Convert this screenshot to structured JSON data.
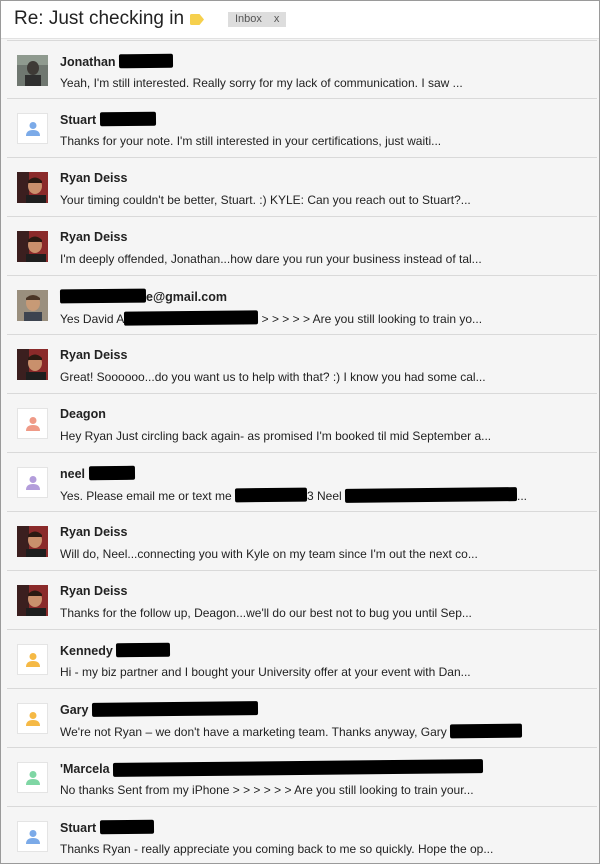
{
  "header": {
    "subject": "Re: Just checking in",
    "label_icon": "label-tag-icon",
    "label_color": "#f6d04d",
    "inbox_chip": "Inbox",
    "inbox_chip_close": "x"
  },
  "messages": [
    {
      "sender": "Jonathan",
      "sender_suffix": "",
      "snippet": "Yeah, I'm still interested. Really sorry for my lack of communication. I saw ...",
      "avatar": "photo-gray"
    },
    {
      "sender": "Stuart",
      "sender_suffix": "",
      "snippet": "Thanks for your note. I'm still interested in your certifications, just waiti...",
      "avatar": "default",
      "avatar_color": "#7baae8"
    },
    {
      "sender": "Ryan Deiss",
      "sender_suffix": "",
      "snippet": "Your timing couldn't be better, Stuart. :) KYLE: Can you reach out to Stuart?...",
      "avatar": "photo-ryan"
    },
    {
      "sender": "Ryan Deiss",
      "sender_suffix": "",
      "snippet": "I'm deeply offended, Jonathan...how dare you run your business instead of tal...",
      "avatar": "photo-ryan"
    },
    {
      "sender": "",
      "sender_suffix": "e@gmail.com",
      "snippet_a": "Yes David A",
      "snippet_b": " > > > > > Are you still looking to train yo...",
      "avatar": "photo-david"
    },
    {
      "sender": "Ryan Deiss",
      "sender_suffix": "",
      "snippet": "Great! Soooooo...do you want us to help with that? :) I know you had some cal...",
      "avatar": "photo-ryan"
    },
    {
      "sender": "Deagon",
      "sender_suffix": "",
      "snippet": "Hey Ryan Just circling back again- as promised I'm booked til mid September a...",
      "avatar": "default",
      "avatar_color": "#ef9a87"
    },
    {
      "sender": "neel",
      "sender_suffix": "",
      "snippet_a": "Yes. Please email me or text me ",
      "snippet_b": "3 Neel ",
      "snippet_c": "...",
      "avatar": "default",
      "avatar_color": "#b39ddb"
    },
    {
      "sender": "Ryan Deiss",
      "sender_suffix": "",
      "snippet": "Will do, Neel...connecting you with Kyle on my team since I'm out the next co...",
      "avatar": "photo-ryan"
    },
    {
      "sender": "Ryan Deiss",
      "sender_suffix": "",
      "snippet": "Thanks for the follow up, Deagon...we'll do our best not to bug you until Sep...",
      "avatar": "photo-ryan"
    },
    {
      "sender": "Kennedy",
      "sender_suffix": "",
      "snippet": "Hi - my biz partner and I bought your University offer at your event with Dan...",
      "avatar": "default",
      "avatar_color": "#f5b945"
    },
    {
      "sender": "Gary",
      "sender_suffix": "",
      "snippet": "We're not Ryan – we don't have a marketing team. Thanks anyway, Gary ",
      "avatar": "default",
      "avatar_color": "#f5b945"
    },
    {
      "sender": "'Marcela",
      "sender_suffix": "",
      "snippet": "No thanks Sent from my iPhone > > > > > > Are you still looking to train your...",
      "avatar": "default",
      "avatar_color": "#7fd6a4"
    },
    {
      "sender": "Stuart",
      "sender_suffix": "",
      "snippet": "Thanks Ryan - really appreciate you coming back to me so quickly. Hope the op...",
      "avatar": "default",
      "avatar_color": "#7baae8"
    }
  ]
}
